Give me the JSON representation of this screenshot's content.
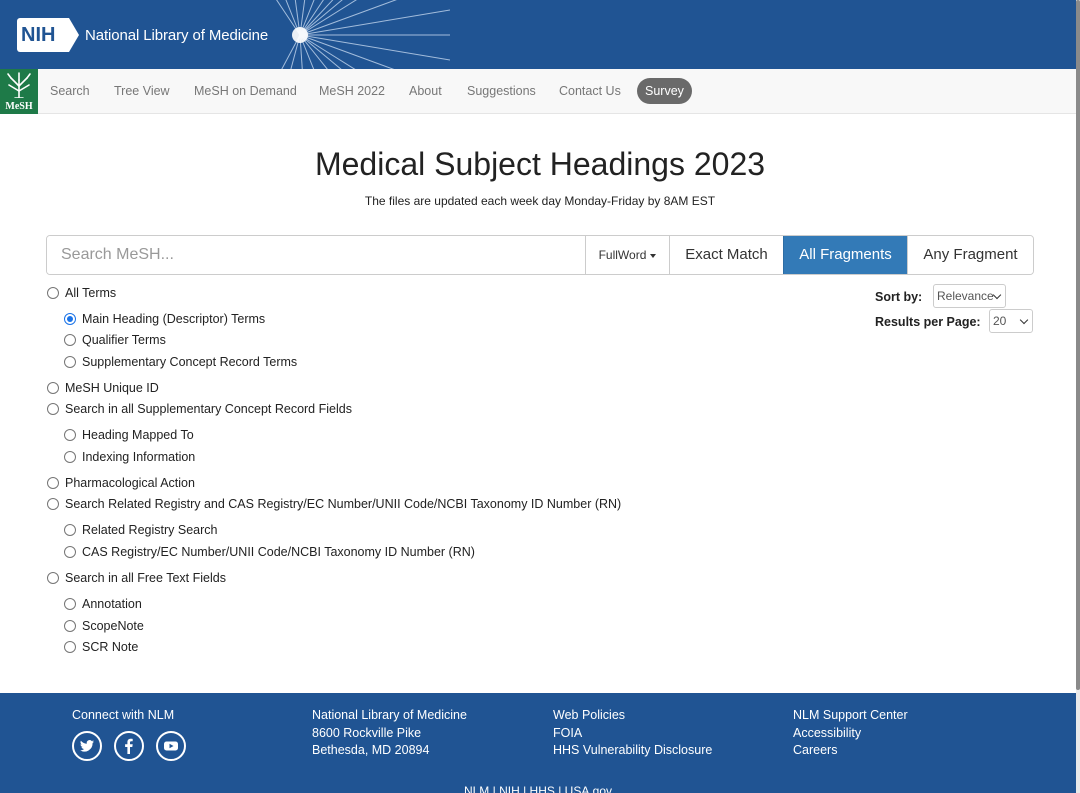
{
  "header": {
    "nih_badge": "NIH",
    "nlm_text": "National Library of Medicine"
  },
  "nav": {
    "logo_text": "MeSH",
    "items": [
      "Search",
      "Tree View",
      "MeSH on Demand",
      "MeSH 2022",
      "About",
      "Suggestions",
      "Contact Us"
    ],
    "survey": "Survey"
  },
  "main": {
    "title": "Medical Subject Headings 2023",
    "subtitle": "The files are updated each week day Monday-Friday by 8AM EST"
  },
  "search": {
    "placeholder": "Search MeSH...",
    "fullword": "FullWord",
    "exact": "Exact Match",
    "all_fragments": "All Fragments",
    "any_fragment": "Any Fragment",
    "selected_mode": "All Fragments"
  },
  "options": {
    "all_terms": "All Terms",
    "main_heading": "Main Heading (Descriptor) Terms",
    "qualifier": "Qualifier Terms",
    "supplementary": "Supplementary Concept Record Terms",
    "unique_id": "MeSH Unique ID",
    "scr_fields": "Search in all Supplementary Concept Record Fields",
    "heading_mapped": "Heading Mapped To",
    "indexing_info": "Indexing Information",
    "pharma": "Pharmacological Action",
    "registry": "Search Related Registry and CAS Registry/EC Number/UNII Code/NCBI Taxonomy ID Number (RN)",
    "related_registry": "Related Registry Search",
    "cas_registry": "CAS Registry/EC Number/UNII Code/NCBI Taxonomy ID Number (RN)",
    "free_text": "Search in all Free Text Fields",
    "annotation": "Annotation",
    "scope_note": "ScopeNote",
    "scr_note": "SCR Note",
    "selected": "Main Heading (Descriptor) Terms"
  },
  "sort": {
    "sort_label": "Sort by:",
    "sort_value": "Relevance",
    "per_page_label": "Results per Page:",
    "per_page_value": "20"
  },
  "footer": {
    "connect": "Connect with NLM",
    "address": [
      "National Library of Medicine",
      "8600 Rockville Pike",
      "Bethesda, MD 20894"
    ],
    "policies": [
      "Web Policies",
      "FOIA",
      "HHS Vulnerability Disclosure"
    ],
    "support": [
      "NLM Support Center",
      "Accessibility",
      "Careers"
    ],
    "bottom": "NLM | NIH | HHS | USA.gov"
  },
  "colors": {
    "brand_blue": "#205493",
    "active_button": "#337ab7",
    "mesh_green": "#1e7a48"
  },
  "icons": [
    "twitter-icon",
    "facebook-icon",
    "youtube-icon",
    "mesh-tree-icon"
  ]
}
